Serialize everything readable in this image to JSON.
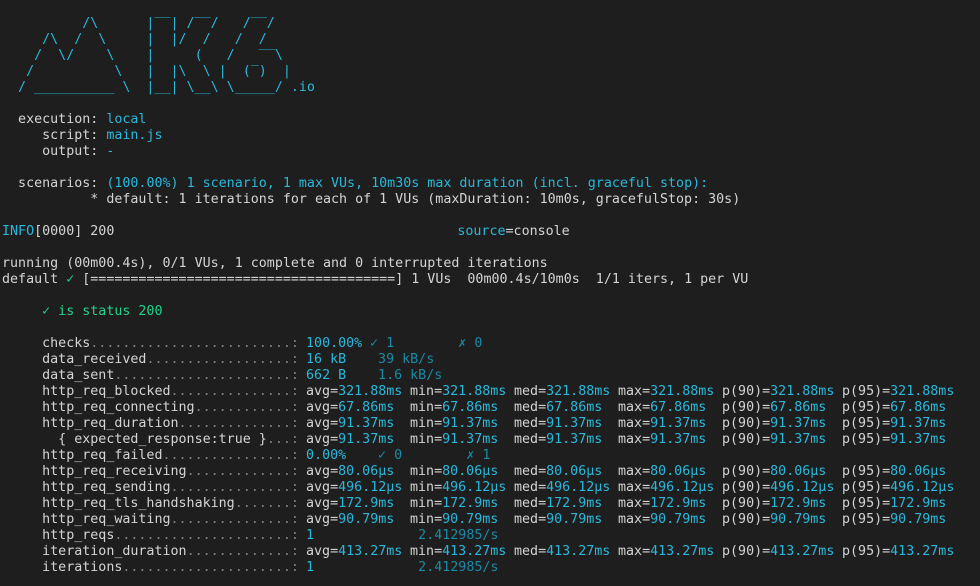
{
  "logo": {
    "lines": [
      "          /\\      |‾‾| /‾‾/   /‾‾/",
      "     /\\  /  \\     |  |/  /   /  /",
      "    /  \\/    \\    |     (   /   ‾‾\\",
      "   /          \\   |  |\\  \\ |  (‾)  |",
      "  / __________ \\  |__| \\__\\ \\_____/"
    ],
    "suffix": " .io"
  },
  "config": {
    "execution_label": "  execution:",
    "execution_value": " local",
    "script_label": "     script:",
    "script_value": " main.js",
    "output_label": "     output:",
    "output_value": " -",
    "scenarios_label": "  scenarios:",
    "scenarios_value": " (100.00%) 1 scenario, 1 max VUs, 10m30s max duration (incl. graceful stop):",
    "default_line": "           * default: 1 iterations for each of 1 VUs (maxDuration: 10m0s, gracefulStop: 30s)"
  },
  "log": {
    "level": "INFO",
    "rest": "[0000] 200",
    "source_key": "source",
    "source_value": "=console"
  },
  "progress": {
    "running_line": "running (00m00.4s), 0/1 VUs, 1 complete and 0 interrupted iterations",
    "default_label": "default",
    "check": " ✓ ",
    "bar": "[======================================]",
    "tail": " 1 VUs  00m00.4s/10m0s  1/1 iters, 1 per VU",
    "fraction": 1.0
  },
  "check_result": "     ✓ is status 200",
  "metrics": [
    {
      "name": "     checks",
      "dots": ".........................:",
      "value": " 100.00%",
      "extra": " ✓ 1        ✗ 0",
      "kind": "rate"
    },
    {
      "name": "     data_received",
      "dots": "..................:",
      "value": " 16 kB",
      "extra": "  39 kB/s",
      "kind": "rate"
    },
    {
      "name": "     data_sent",
      "dots": "......................:",
      "value": " 662 B",
      "extra": "  1.6 kB/s",
      "kind": "rate"
    },
    {
      "name": "     http_req_blocked",
      "dots": "...............:",
      "avg": "321.88ms",
      "min": "321.88ms",
      "med": "321.88ms",
      "max": "321.88ms",
      "p90": "321.88ms",
      "p95": "321.88ms",
      "kind": "trend"
    },
    {
      "name": "     http_req_connecting",
      "dots": "............:",
      "avg": "67.86ms",
      "min": "67.86ms",
      "med": "67.86ms",
      "max": "67.86ms",
      "p90": "67.86ms",
      "p95": "67.86ms",
      "kind": "trend"
    },
    {
      "name": "     http_req_duration",
      "dots": "..............:",
      "avg": "91.37ms",
      "min": "91.37ms",
      "med": "91.37ms",
      "max": "91.37ms",
      "p90": "91.37ms",
      "p95": "91.37ms",
      "kind": "trend"
    },
    {
      "name": "       { expected_response:true }",
      "dots": "...:",
      "avg": "91.37ms",
      "min": "91.37ms",
      "med": "91.37ms",
      "max": "91.37ms",
      "p90": "91.37ms",
      "p95": "91.37ms",
      "kind": "trend"
    },
    {
      "name": "     http_req_failed",
      "dots": "................:",
      "value": " 0.00%",
      "extra": "  ✓ 0        ✗ 1",
      "kind": "rate"
    },
    {
      "name": "     http_req_receiving",
      "dots": ".............:",
      "avg": "80.06µs",
      "min": "80.06µs",
      "med": "80.06µs",
      "max": "80.06µs",
      "p90": "80.06µs",
      "p95": "80.06µs",
      "kind": "trend"
    },
    {
      "name": "     http_req_sending",
      "dots": "...............:",
      "avg": "496.12µs",
      "min": "496.12µs",
      "med": "496.12µs",
      "max": "496.12µs",
      "p90": "496.12µs",
      "p95": "496.12µs",
      "kind": "trend"
    },
    {
      "name": "     http_req_tls_handshaking",
      "dots": ".......:",
      "avg": "172.9ms",
      "min": "172.9ms",
      "med": "172.9ms",
      "max": "172.9ms",
      "p90": "172.9ms",
      "p95": "172.9ms",
      "kind": "trend"
    },
    {
      "name": "     http_req_waiting",
      "dots": "...............:",
      "avg": "90.79ms",
      "min": "90.79ms",
      "med": "90.79ms",
      "max": "90.79ms",
      "p90": "90.79ms",
      "p95": "90.79ms",
      "kind": "trend"
    },
    {
      "name": "     http_reqs",
      "dots": "......................:",
      "value": " 1",
      "extra": "       2.412985/s",
      "kind": "rate"
    },
    {
      "name": "     iteration_duration",
      "dots": ".............:",
      "avg": "413.27ms",
      "min": "413.27ms",
      "med": "413.27ms",
      "max": "413.27ms",
      "p90": "413.27ms",
      "p95": "413.27ms",
      "kind": "trend"
    },
    {
      "name": "     iterations",
      "dots": ".....................:",
      "value": " 1",
      "extra": "       2.412985/s",
      "kind": "rate"
    }
  ],
  "stat_labels": {
    "avg": "avg=",
    "min": "min=",
    "med": "med=",
    "max": "max=",
    "p90": "p(90)=",
    "p95": "p(95)="
  },
  "colors": {
    "background": "#1e1e1e",
    "cyan": "#29b8db",
    "green": "#23d18b",
    "text": "#d4d4d4",
    "dim": "#7f7f7f"
  }
}
